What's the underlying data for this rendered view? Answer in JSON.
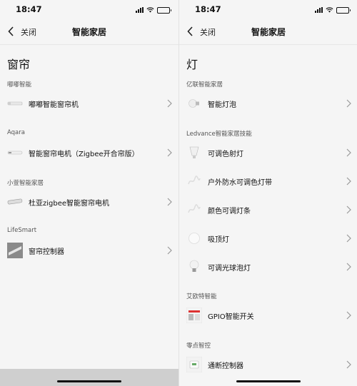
{
  "status": {
    "time": "18:47"
  },
  "nav": {
    "close_label": "关闭",
    "title": "智能家居"
  },
  "left": {
    "heading": "窗帘",
    "sections": [
      {
        "label": "嘟嘟智能",
        "items": [
          {
            "label": "嘟嘟智能窗帘机",
            "icon": "curtain-rail-icon"
          }
        ]
      },
      {
        "label": "Aqara",
        "items": [
          {
            "label": "智能窗帘电机（Zigbee开合帘版）",
            "icon": "curtain-motor-icon"
          }
        ]
      },
      {
        "label": "小萱智能家居",
        "items": [
          {
            "label": "杜亚zigbee智能窗帘电机",
            "icon": "curtain-motor-icon"
          }
        ]
      },
      {
        "label": "LifeSmart",
        "items": [
          {
            "label": "窗帘控制器",
            "icon": "curtain-controller-icon"
          }
        ]
      }
    ]
  },
  "right": {
    "heading": "灯",
    "sections": [
      {
        "label": "亿联智能家居",
        "items": [
          {
            "label": "智能灯泡",
            "icon": "bulb-icon"
          }
        ]
      },
      {
        "label": "Ledvance智能家居技能",
        "items": [
          {
            "label": "可调色射灯",
            "icon": "spotlight-icon"
          },
          {
            "label": "户外防水可调色灯带",
            "icon": "light-strip-icon"
          },
          {
            "label": "颜色可调灯条",
            "icon": "light-strip-icon"
          },
          {
            "label": "吸顶灯",
            "icon": "ceiling-light-icon"
          },
          {
            "label": "可调光球泡灯",
            "icon": "bulb-icon"
          }
        ]
      },
      {
        "label": "艾欧特智能",
        "items": [
          {
            "label": "GPIO智能开关",
            "icon": "switch-module-icon"
          }
        ]
      },
      {
        "label": "零点智控",
        "items": [
          {
            "label": "通断控制器",
            "icon": "controller-icon"
          }
        ]
      }
    ]
  }
}
